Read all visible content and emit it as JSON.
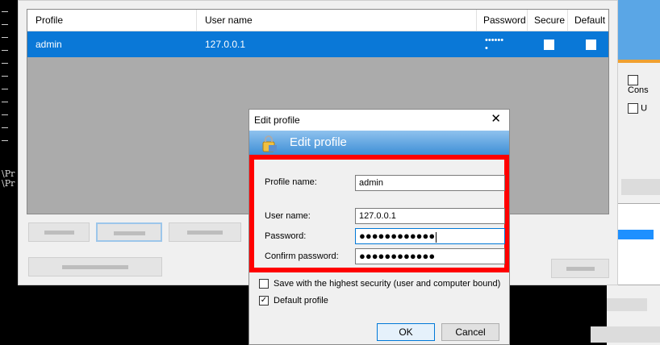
{
  "console": {
    "lines": [
      "\\Pr",
      "\\Pr"
    ]
  },
  "background_window": {
    "options": [
      "Cons",
      "U"
    ]
  },
  "grid": {
    "columns": [
      "Profile",
      "User name",
      "Password",
      "Secure",
      "Default"
    ],
    "rows": [
      {
        "profile": "admin",
        "user_name": "127.0.0.1",
        "password": "••••••\n•"
      }
    ]
  },
  "dialog": {
    "title": "Edit profile",
    "close_glyph": "✕",
    "banner": "Edit profile",
    "fields": {
      "profile_name_label": "Profile name:",
      "profile_name_value": "admin",
      "user_name_label": "User name:",
      "user_name_value": "127.0.0.1",
      "password_label": "Password:",
      "password_value": "●●●●●●●●●●●●",
      "confirm_label": "Confirm password:",
      "confirm_value": "●●●●●●●●●●●●"
    },
    "options": {
      "high_security_label": "Save with the highest security (user and computer bound)",
      "high_security_checked": false,
      "default_label": "Default profile",
      "default_checked": true,
      "check_glyph": "✓"
    },
    "buttons": {
      "ok": "OK",
      "cancel": "Cancel"
    }
  },
  "colors": {
    "selection": "#0a78d7",
    "highlight_box": "#ff0000",
    "banner_top": "#8fc2ee",
    "banner_bottom": "#3f8fd6"
  }
}
